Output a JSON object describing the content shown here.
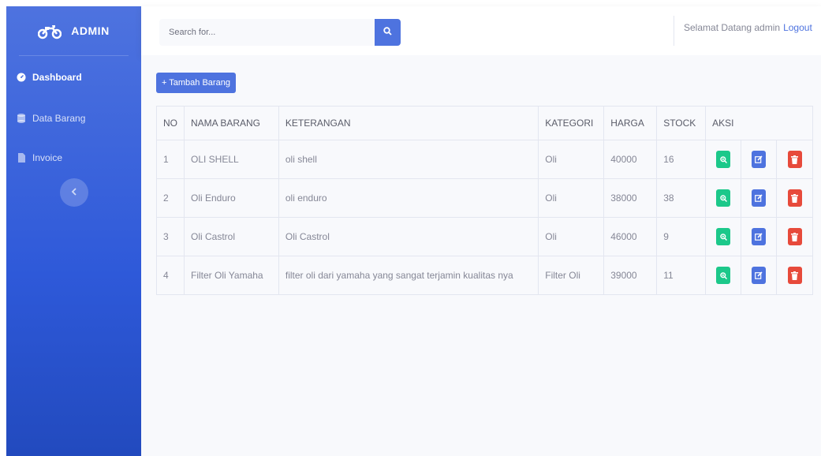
{
  "sidebar": {
    "brand": "ADMIN",
    "items": [
      {
        "label": "Dashboard",
        "icon": "tachometer-icon",
        "active": true
      },
      {
        "label": "Data Barang",
        "icon": "database-icon",
        "active": false
      },
      {
        "label": "Invoice",
        "icon": "file-icon",
        "active": false
      }
    ],
    "toggle_icon": "chevron-left-icon"
  },
  "topbar": {
    "search": {
      "placeholder": "Search for...",
      "value": ""
    },
    "greeting": "Selamat Datang admin",
    "logout_label": "Logout"
  },
  "content": {
    "add_button_label": "+ Tambah Barang",
    "table": {
      "headers": [
        "NO",
        "NAMA BARANG",
        "KETERANGAN",
        "KATEGORI",
        "HARGA",
        "STOCK",
        "AKSI"
      ],
      "rows": [
        {
          "no": "1",
          "nama": "OLI SHELL",
          "keterangan": "oli shell",
          "kategori": "Oli",
          "harga": "40000",
          "stock": "16"
        },
        {
          "no": "2",
          "nama": "Oli Enduro",
          "keterangan": "oli enduro",
          "kategori": "Oli",
          "harga": "38000",
          "stock": "38"
        },
        {
          "no": "3",
          "nama": "Oli Castrol",
          "keterangan": "Oli Castrol",
          "kategori": "Oli",
          "harga": "46000",
          "stock": "9"
        },
        {
          "no": "4",
          "nama": "Filter Oli Yamaha",
          "keterangan": "filter oli dari yamaha yang sangat terjamin kualitas nya",
          "kategori": "Filter Oli",
          "harga": "39000",
          "stock": "11"
        }
      ]
    }
  },
  "colors": {
    "primary": "#4e73df",
    "success": "#1cc88a",
    "danger": "#e74a3b",
    "text": "#858796"
  }
}
